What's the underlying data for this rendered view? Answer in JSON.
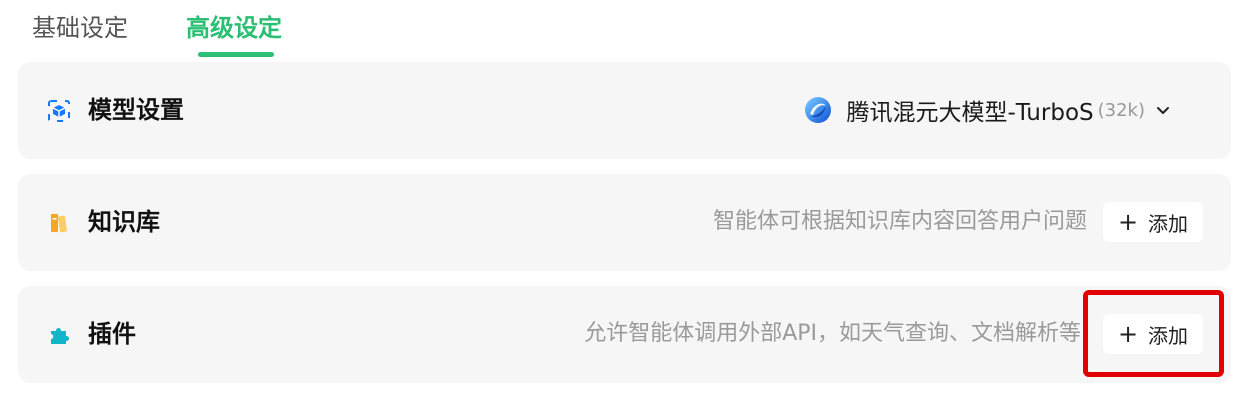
{
  "tabs": [
    {
      "label": "基础设定",
      "active": false
    },
    {
      "label": "高级设定",
      "active": true
    }
  ],
  "accent_color": "#2bbf73",
  "sections": {
    "model": {
      "title": "模型设置",
      "icon": "model-cube-icon",
      "selected_model": "腾讯混元大模型-TurboS",
      "context": "(32k)"
    },
    "knowledge": {
      "title": "知识库",
      "icon": "books-icon",
      "description": "智能体可根据知识库内容回答用户问题",
      "add_label": "添加"
    },
    "plugins": {
      "title": "插件",
      "icon": "puzzle-icon",
      "description": "允许智能体调用外部API，如天气查询、文档解析等",
      "add_label": "添加"
    }
  },
  "highlight_color": "#e00000"
}
